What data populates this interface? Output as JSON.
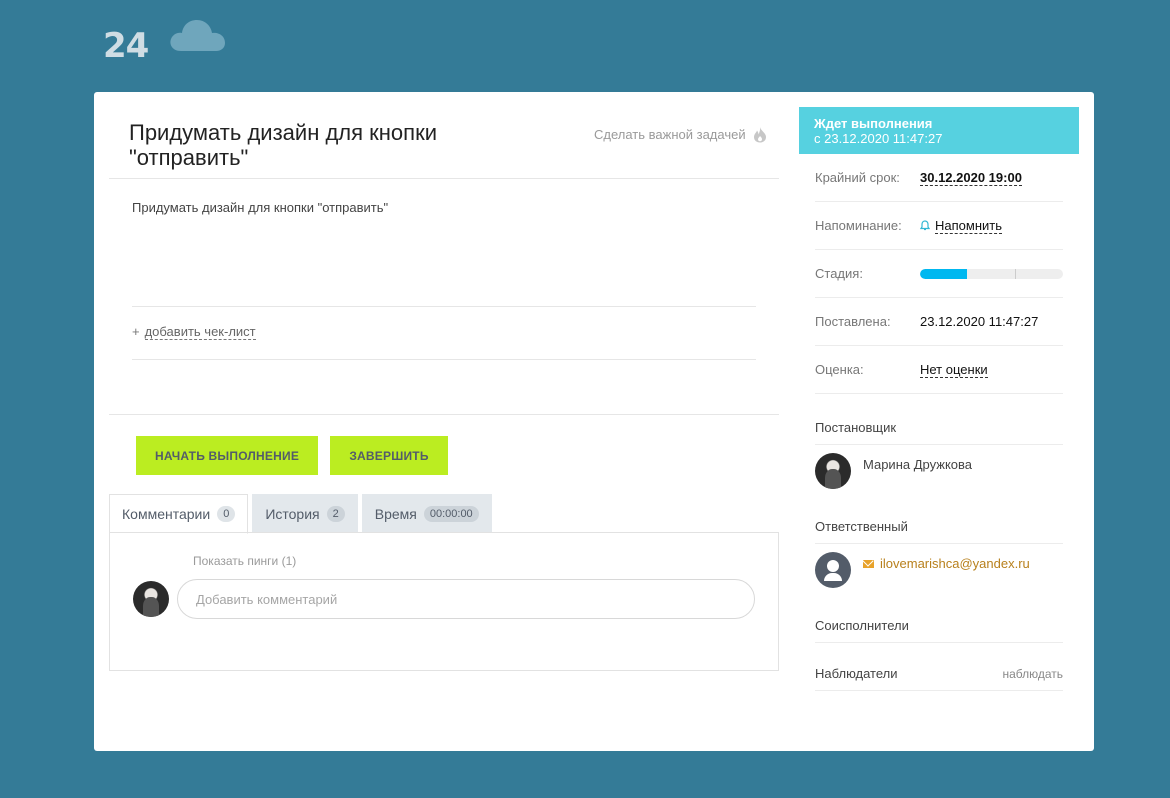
{
  "logo": {
    "text": "24"
  },
  "task": {
    "title": "Придумать дизайн для кнопки \"отправить\"",
    "important_label": "Сделать важной задачей",
    "description": "Придумать дизайн для кнопки \"отправить\"",
    "checklist_plus": "+",
    "checklist_label": "добавить чек-лист"
  },
  "buttons": {
    "start": "НАЧАТЬ ВЫПОЛНЕНИЕ",
    "finish": "ЗАВЕРШИТЬ"
  },
  "tabs": [
    {
      "label": "Комментарии",
      "count": "0"
    },
    {
      "label": "История",
      "count": "2"
    },
    {
      "label": "Время",
      "count": "00:00:00"
    }
  ],
  "comments": {
    "show_pings": "Показать пинги (1)",
    "placeholder": "Добавить комментарий"
  },
  "status": {
    "line1": "Ждет выполнения",
    "line2": "с 23.12.2020 11:47:27"
  },
  "details": {
    "deadline_label": "Крайний срок:",
    "deadline_value": "30.12.2020 19:00",
    "reminder_label": "Напоминание:",
    "reminder_value": "Напомнить",
    "stage_label": "Стадия:",
    "stage_fraction": 0.33,
    "created_label": "Поставлена:",
    "created_value": "23.12.2020 11:47:27",
    "rating_label": "Оценка:",
    "rating_value": "Нет оценки"
  },
  "people": {
    "creator_label": "Постановщик",
    "creator_name": "Марина Дружкова",
    "responsible_label": "Ответственный",
    "responsible_email": "ilovemarishca@yandex.ru",
    "coexecutors_label": "Соисполнители",
    "observers_label": "Наблюдатели",
    "observe_link": "наблюдать"
  },
  "colors": {
    "background": "#347b97",
    "status_banner": "#56d1e0",
    "action_button": "#bbed21",
    "stage_fill": "#00b8f0",
    "email_link": "#b8801c"
  },
  "icons": [
    "cloud-icon",
    "flame-icon",
    "bell-icon",
    "mail-icon"
  ]
}
